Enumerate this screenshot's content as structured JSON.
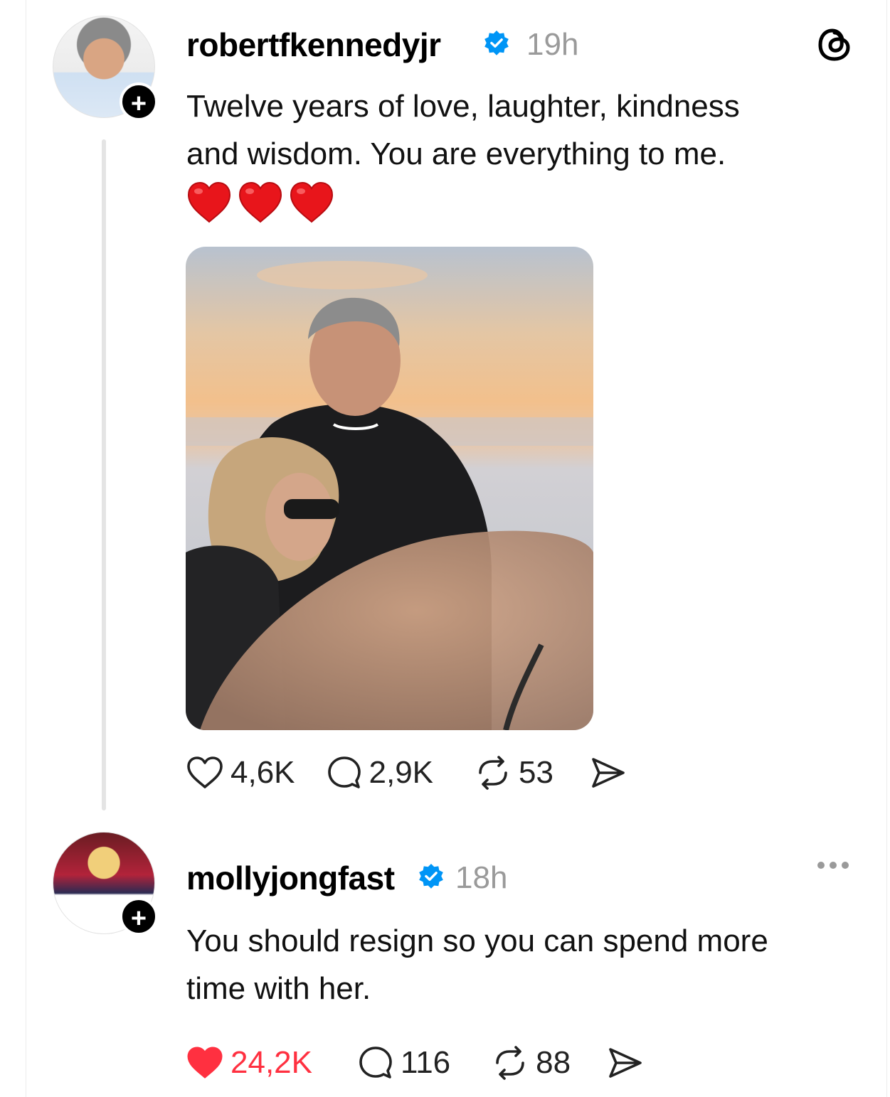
{
  "post": {
    "username": "robertfkennedyjr",
    "timestamp": "19h",
    "text_line1": "Twelve years of love, laughter, kindness",
    "text_line2": "and wisdom. You are everything to me.",
    "emojis": "❤️❤️❤️",
    "likes": "4,6K",
    "comments": "2,9K",
    "reposts": "53"
  },
  "reply": {
    "username": "mollyjongfast",
    "timestamp": "18h",
    "text_line1": "You should resign so you can spend more",
    "text_line2": "time with her.",
    "likes": "24,2K",
    "comments": "116",
    "reposts": "88"
  },
  "icons": {
    "app_logo": "threads-logo-icon",
    "verified": "verified-badge-icon",
    "like": "heart-icon",
    "comment": "comment-bubble-icon",
    "repost": "repost-icon",
    "share": "send-icon",
    "more": "more-dots-icon",
    "follow": "plus-icon"
  },
  "colors": {
    "verified_blue": "#0095f6",
    "liked_red": "#ff3040",
    "muted_gray": "#9a9a9a"
  }
}
